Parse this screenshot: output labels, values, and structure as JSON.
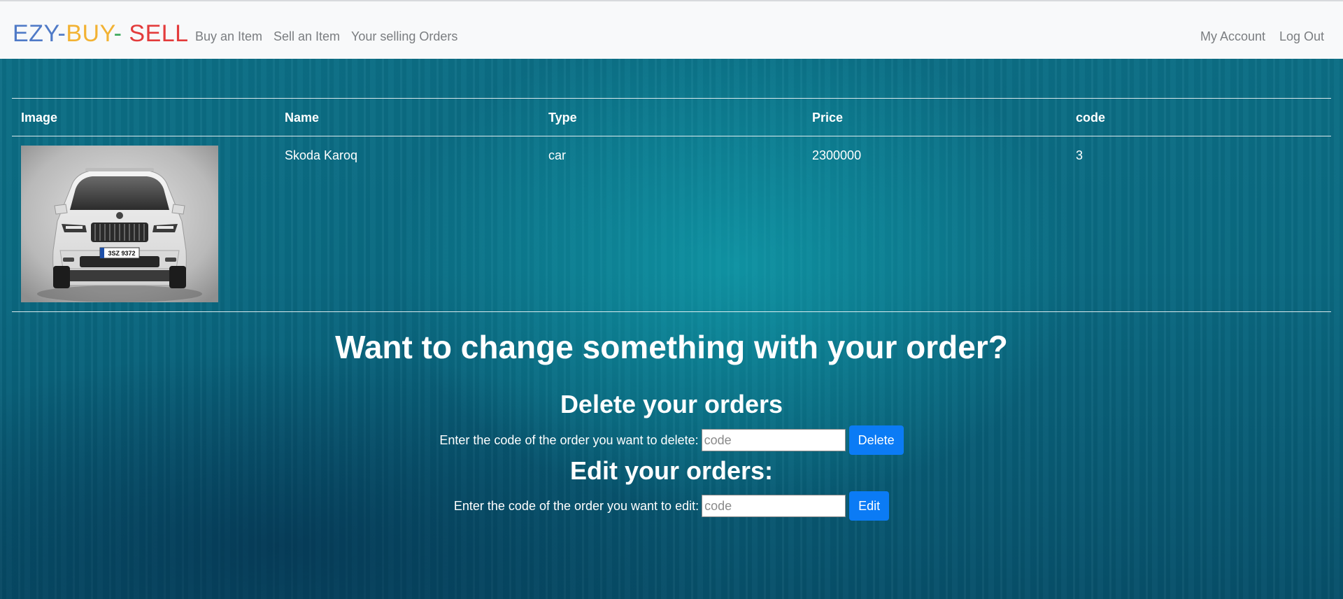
{
  "navbar": {
    "brand": {
      "part1": "EZY",
      "sep1": "-",
      "part2": "BUY",
      "sep2": "- ",
      "part3": "SELL",
      "colors": {
        "part1": "#4f7ac7",
        "part2": "#f2b233",
        "sep": "#3aa85a",
        "part3": "#e33b3b"
      }
    },
    "links": [
      {
        "label": "Buy an Item"
      },
      {
        "label": "Sell an Item"
      },
      {
        "label": "Your selling Orders"
      }
    ],
    "right_links": [
      {
        "label": "My Account"
      },
      {
        "label": "Log Out"
      }
    ]
  },
  "table": {
    "headers": [
      "Image",
      "Name",
      "Type",
      "Price",
      "code"
    ],
    "rows": [
      {
        "image": "car-photo",
        "name": "Skoda Karoq",
        "type": "car",
        "price": "2300000",
        "code": "3",
        "plate": "3SZ 9372"
      }
    ]
  },
  "main": {
    "heading": "Want to change something with your order?",
    "delete_section": {
      "title": "Delete your orders",
      "label": "Enter the code of the order you want to delete:",
      "placeholder": "code",
      "button": "Delete"
    },
    "edit_section": {
      "title": "Edit your orders:",
      "label": "Enter the code of the order you want to edit:",
      "placeholder": "code",
      "button": "Edit"
    }
  },
  "colors": {
    "accent_button": "#0b7bf5",
    "navbar_bg": "#f8f9fa",
    "page_bg": "#0b5f74"
  }
}
